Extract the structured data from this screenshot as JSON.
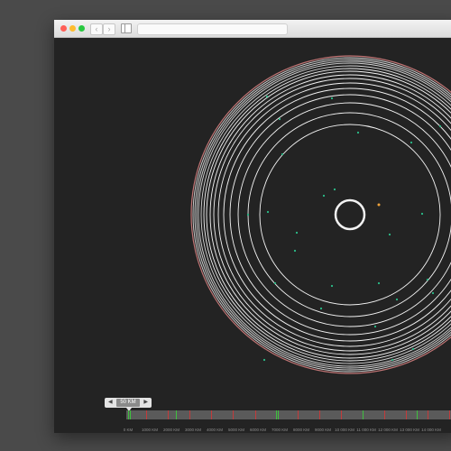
{
  "window": {
    "buttons": [
      "close",
      "minimize",
      "zoom"
    ],
    "nav": {
      "back_icon": "‹",
      "forward_icon": "›"
    },
    "url": ""
  },
  "colors": {
    "background": "#232323",
    "ring": "#ffffff",
    "outer_ring": "#e88a8a",
    "dot_green": "#2bbf8a",
    "dot_orange": "#f0a23a",
    "track_red": "#c33a3a",
    "track_green": "#3fbf3f"
  },
  "slider": {
    "value_label": "50 KM",
    "left_arrow": "◀",
    "right_arrow": "▶",
    "ticks": [
      "0 KM",
      "1000 KM",
      "2000 KM",
      "3000 KM",
      "4000 KM",
      "5000 KM",
      "6000 KM",
      "7000 KM",
      "8000 KM",
      "9000 KM",
      "10 000 KM",
      "11 000 KM",
      "12 000 KM",
      "13 000 KM",
      "14 000 KM"
    ]
  }
}
